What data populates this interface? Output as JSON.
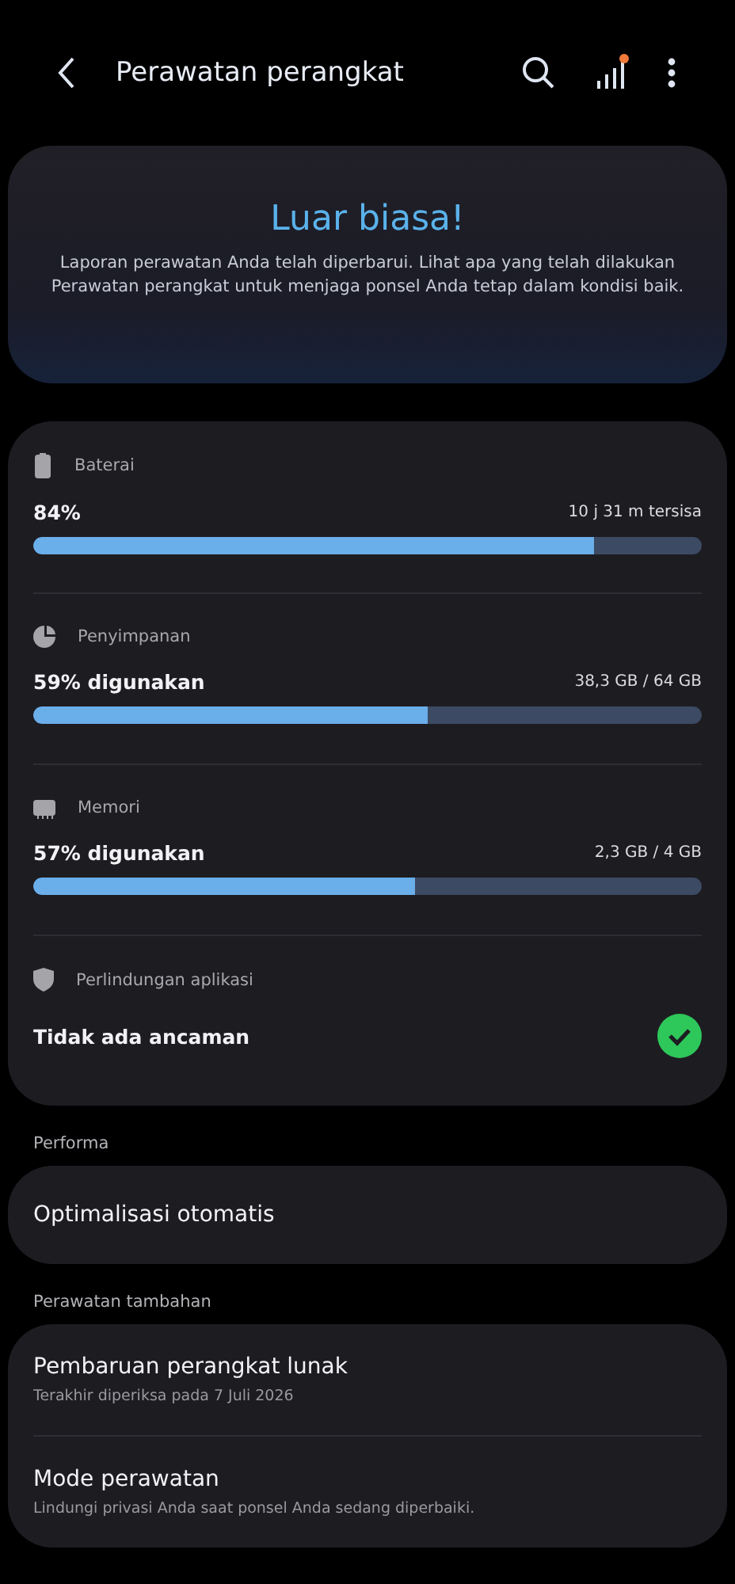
{
  "header": {
    "title": "Perawatan perangkat",
    "notification": true
  },
  "summary": {
    "title": "Luar biasa!",
    "text": "Laporan perawatan Anda telah diperbarui. Lihat apa yang telah dilakukan Perawatan perangkat untuk menjaga ponsel Anda tetap dalam kondisi baik."
  },
  "stats": [
    {
      "kind": "battery",
      "label": "Baterai",
      "value": "84%",
      "detail": "10 j 31 m tersisa",
      "level": 0.84
    },
    {
      "kind": "storage",
      "label": "Penyimpanan",
      "value": "59% digunakan",
      "detail": "38,3 GB / 64 GB",
      "level": 0.59
    },
    {
      "kind": "memory",
      "label": "Memori",
      "value": "57% digunakan",
      "detail": "2,3 GB / 4 GB",
      "level": 0.57
    },
    {
      "kind": "protection",
      "label": "Perlindungan aplikasi",
      "value": "Tidak ada ancaman",
      "safe": true
    }
  ],
  "sections": [
    {
      "label": "Performa",
      "items": [
        {
          "title": "Optimalisasi otomatis"
        }
      ]
    },
    {
      "label": "Perawatan tambahan",
      "items": [
        {
          "title": "Pembaruan perangkat lunak",
          "subtitle": "Terakhir diperiksa pada 7 Juli 2026"
        },
        {
          "title": "Mode perawatan",
          "subtitle": "Lindungi privasi Anda saat ponsel Anda sedang diperbaiki."
        }
      ]
    }
  ]
}
